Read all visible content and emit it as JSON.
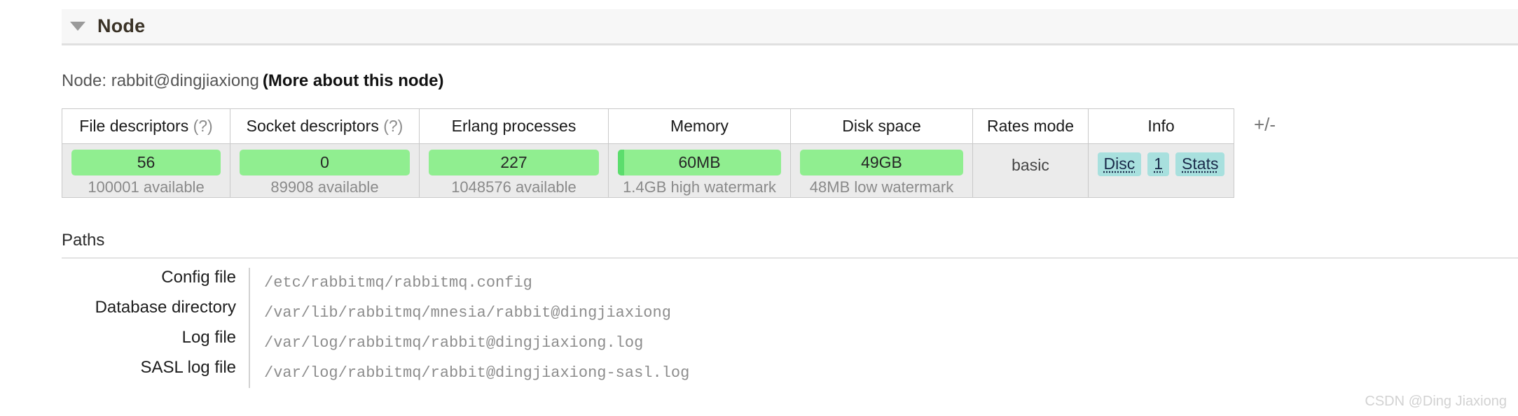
{
  "section": {
    "title": "Node",
    "collapse_icon": "triangle-down-icon"
  },
  "node_line": {
    "prefix": "Node: rabbit@dingjiaxiong",
    "more_link": "(More about this node)"
  },
  "stats_table": {
    "plus_minus": "+/-",
    "columns": [
      {
        "label": "File descriptors",
        "help": "(?)"
      },
      {
        "label": "Socket descriptors",
        "help": "(?)"
      },
      {
        "label": "Erlang processes",
        "help": ""
      },
      {
        "label": "Memory",
        "help": ""
      },
      {
        "label": "Disk space",
        "help": ""
      },
      {
        "label": "Rates mode",
        "help": ""
      },
      {
        "label": "Info",
        "help": ""
      }
    ],
    "cells": {
      "file_descriptors": {
        "value": "56",
        "sub": "100001 available"
      },
      "socket_descriptors": {
        "value": "0",
        "sub": "89908 available"
      },
      "erlang_processes": {
        "value": "227",
        "sub": "1048576 available"
      },
      "memory": {
        "value": "60MB",
        "sub": "1.4GB high watermark"
      },
      "disk_space": {
        "value": "49GB",
        "sub": "48MB low watermark"
      },
      "rates_mode": {
        "value": "basic"
      },
      "info_badges": [
        "Disc",
        "1",
        "Stats"
      ]
    },
    "bar_color": "#90ee90",
    "bar_accent_color": "#5cdd6d",
    "badge_color": "#a8e0de"
  },
  "paths": {
    "title": "Paths",
    "rows": [
      {
        "label": "Config file",
        "value": "/etc/rabbitmq/rabbitmq.config"
      },
      {
        "label": "Database directory",
        "value": "/var/lib/rabbitmq/mnesia/rabbit@dingjiaxiong"
      },
      {
        "label": "Log file",
        "value": "/var/log/rabbitmq/rabbit@dingjiaxiong.log"
      },
      {
        "label": "SASL log file",
        "value": "/var/log/rabbitmq/rabbit@dingjiaxiong-sasl.log"
      }
    ]
  },
  "watermark": "CSDN @Ding Jiaxiong"
}
